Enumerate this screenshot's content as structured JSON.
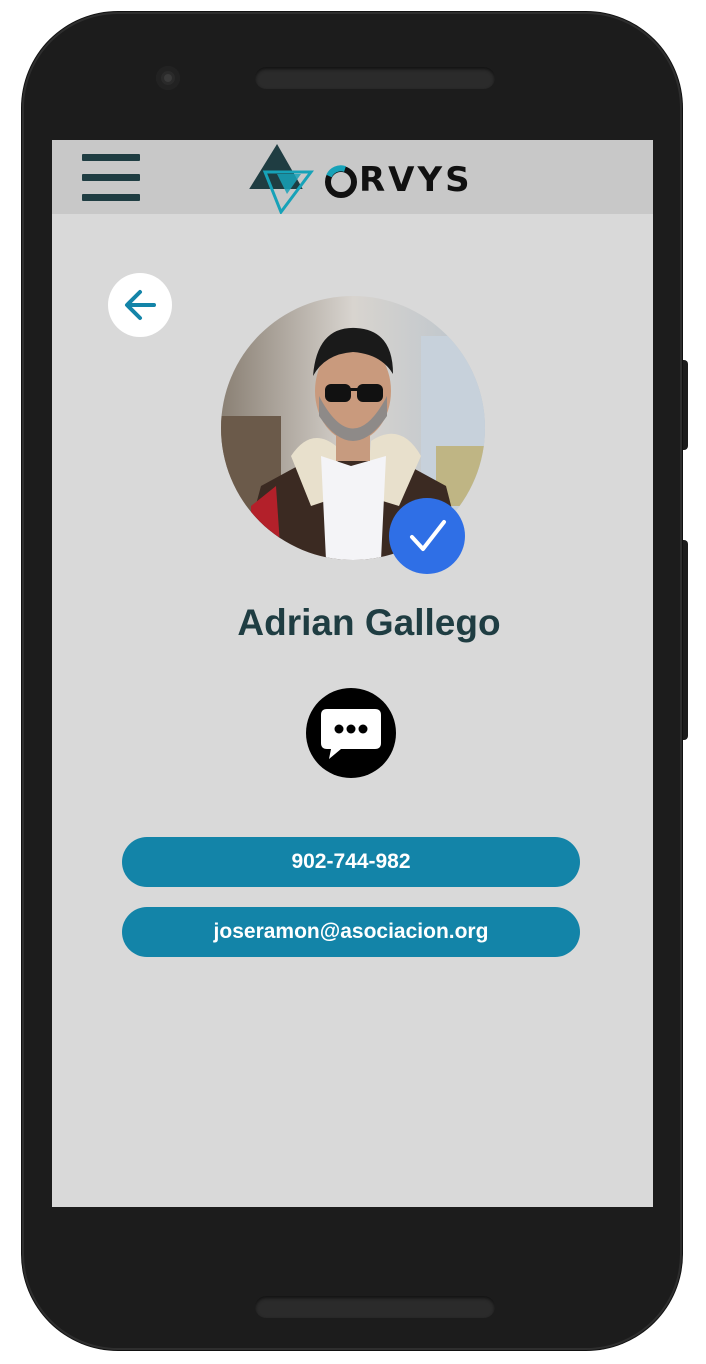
{
  "app": {
    "brand": "ORVYS"
  },
  "profile": {
    "name": "Adrian Gallego",
    "verified": true,
    "phone": "902-744-982",
    "email": "joseramon@asociacion.org"
  },
  "colors": {
    "screen_bg": "#d9d9d9",
    "appbar_bg": "#c8c8c8",
    "accent_teal": "#1384a8",
    "dark_teal": "#1f3d42",
    "verified_blue": "#2f6fe6"
  },
  "icons": {
    "menu": "hamburger-icon",
    "back": "arrow-left-icon",
    "verified": "checkmark-icon",
    "chat": "chat-bubble-icon"
  }
}
